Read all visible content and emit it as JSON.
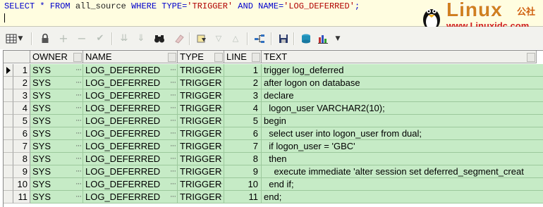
{
  "sql": {
    "kw_select": "SELECT",
    "star": " * ",
    "kw_from": "FROM",
    "table": " all_source ",
    "kw_where": "WHERE",
    "col1": " TYPE",
    "eq1": "=",
    "val1": "'TRIGGER'",
    "kw_and": " AND ",
    "col2": "NAME",
    "eq2": "=",
    "val2": "'LOG_DEFERRED'",
    "semi": ";"
  },
  "logo": {
    "word": "Linux",
    "cn": "公社",
    "url": "www.Linuxidc.com"
  },
  "toolbar": {
    "icons": [
      "grid-view-icon",
      "dropdown-arrow-icon",
      "lock-icon",
      "add-row-icon",
      "remove-row-icon",
      "post-check-icon",
      "filter-down-icon",
      "filter-clear-icon",
      "find-binoculars-icon",
      "clear-eraser-icon",
      "fetch-icon",
      "sort-down-icon",
      "sort-up-icon",
      "query-plan-icon",
      "save-icon",
      "export-icon",
      "chart-icon",
      "dropdown-arrow-icon-2"
    ]
  },
  "grid": {
    "columns": [
      "OWNER",
      "NAME",
      "TYPE",
      "LINE",
      "TEXT"
    ],
    "rows": [
      {
        "n": "1",
        "owner": "SYS",
        "name": "LOG_DEFERRED",
        "type": "TRIGGER",
        "line": "1",
        "text": "trigger log_deferred"
      },
      {
        "n": "2",
        "owner": "SYS",
        "name": "LOG_DEFERRED",
        "type": "TRIGGER",
        "line": "2",
        "text": "after logon on database"
      },
      {
        "n": "3",
        "owner": "SYS",
        "name": "LOG_DEFERRED",
        "type": "TRIGGER",
        "line": "3",
        "text": "declare"
      },
      {
        "n": "4",
        "owner": "SYS",
        "name": "LOG_DEFERRED",
        "type": "TRIGGER",
        "line": "4",
        "text": "  logon_user VARCHAR2(10);"
      },
      {
        "n": "5",
        "owner": "SYS",
        "name": "LOG_DEFERRED",
        "type": "TRIGGER",
        "line": "5",
        "text": "begin"
      },
      {
        "n": "6",
        "owner": "SYS",
        "name": "LOG_DEFERRED",
        "type": "TRIGGER",
        "line": "6",
        "text": "  select user into logon_user from dual;"
      },
      {
        "n": "7",
        "owner": "SYS",
        "name": "LOG_DEFERRED",
        "type": "TRIGGER",
        "line": "7",
        "text": "  if logon_user = 'GBC'"
      },
      {
        "n": "8",
        "owner": "SYS",
        "name": "LOG_DEFERRED",
        "type": "TRIGGER",
        "line": "8",
        "text": "  then"
      },
      {
        "n": "9",
        "owner": "SYS",
        "name": "LOG_DEFERRED",
        "type": "TRIGGER",
        "line": "9",
        "text": "    execute immediate 'alter session set deferred_segment_creat"
      },
      {
        "n": "10",
        "owner": "SYS",
        "name": "LOG_DEFERRED",
        "type": "TRIGGER",
        "line": "10",
        "text": "  end if;"
      },
      {
        "n": "11",
        "owner": "SYS",
        "name": "LOG_DEFERRED",
        "type": "TRIGGER",
        "line": "11",
        "text": "end;"
      }
    ]
  },
  "colors": {
    "row_bg": "#c6ebc6",
    "header_bg": "#f0f0ec",
    "sql_keyword": "#0000cc",
    "sql_string": "#b00000",
    "logo_orange": "#d08020",
    "logo_red": "#d02020"
  }
}
